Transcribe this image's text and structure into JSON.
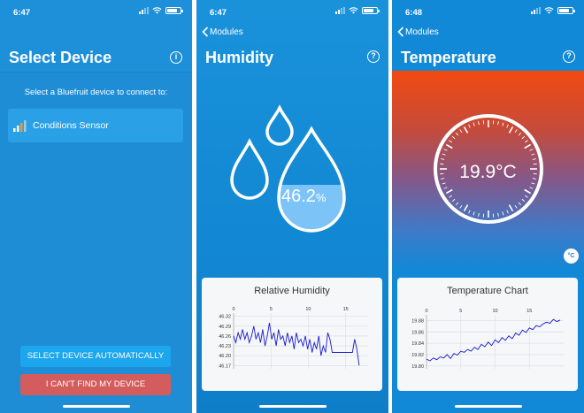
{
  "screens": [
    {
      "status": {
        "time": "6:47"
      },
      "title": "Select Device",
      "prompt": "Select a Bluefruit device to connect to:",
      "device": {
        "name": "Conditions Sensor"
      },
      "buttons": {
        "auto": "SELECT DEVICE AUTOMATICALLY",
        "help": "I CAN'T FIND MY DEVICE"
      }
    },
    {
      "status": {
        "time": "6:47"
      },
      "back": "Modules",
      "title": "Humidity",
      "reading": {
        "value": "46.2",
        "unit": "%"
      },
      "chart_title": "Relative Humidity"
    },
    {
      "status": {
        "time": "6:48"
      },
      "back": "Modules",
      "title": "Temperature",
      "reading": "19.9°C",
      "unit_toggle": "°C",
      "chart_title": "Temperature Chart"
    }
  ],
  "colors": {
    "primary": "#1289d6",
    "danger": "#d55c5c",
    "accent": "#1ba6ee"
  },
  "chart_data": [
    {
      "type": "line",
      "title": "Relative Humidity",
      "xlim": [
        0,
        18
      ],
      "ylim": [
        46.16,
        46.33
      ],
      "xticks": [
        "0",
        "5",
        "10",
        "15"
      ],
      "yticks": [
        "46.32",
        "46.29",
        "46.26",
        "46.23",
        "46.20",
        "46.17"
      ],
      "x": [
        0,
        0.3,
        0.6,
        0.9,
        1.2,
        1.5,
        1.8,
        2.1,
        2.4,
        2.7,
        3,
        3.3,
        3.6,
        3.9,
        4.2,
        4.5,
        4.8,
        5.1,
        5.4,
        5.7,
        6,
        6.3,
        6.6,
        6.9,
        7.2,
        7.5,
        7.8,
        8.1,
        8.4,
        8.7,
        9,
        9.3,
        9.6,
        9.9,
        10.2,
        10.5,
        10.8,
        11.1,
        11.4,
        11.7,
        12,
        12.3,
        12.6,
        12.9,
        13.2,
        13.5,
        13.8,
        14.1,
        14.4,
        14.7,
        15,
        15.3,
        15.6,
        15.9,
        16.2,
        16.5,
        16.8
      ],
      "y": [
        46.26,
        46.24,
        46.27,
        46.25,
        46.28,
        46.25,
        46.27,
        46.24,
        46.26,
        46.29,
        46.25,
        46.27,
        46.24,
        46.28,
        46.23,
        46.26,
        46.3,
        46.25,
        46.27,
        46.23,
        46.28,
        46.25,
        46.26,
        46.23,
        46.27,
        46.24,
        46.26,
        46.22,
        46.27,
        46.24,
        46.25,
        46.23,
        46.26,
        46.22,
        46.25,
        46.21,
        46.24,
        46.22,
        46.26,
        46.2,
        46.23,
        46.21,
        46.27,
        46.25,
        46.21,
        46.21,
        46.21,
        46.21,
        46.21,
        46.21,
        46.21,
        46.21,
        46.21,
        46.21,
        46.25,
        46.22,
        46.17
      ]
    },
    {
      "type": "line",
      "title": "Temperature Chart",
      "xlim": [
        0,
        20
      ],
      "ylim": [
        19.795,
        19.89
      ],
      "xticks": [
        "0",
        "5",
        "10",
        "15"
      ],
      "yticks": [
        "19.88",
        "19.86",
        "19.84",
        "19.82",
        "19.80"
      ],
      "x": [
        0,
        0.5,
        1,
        1.5,
        2,
        2.5,
        3,
        3.5,
        4,
        4.5,
        5,
        5.5,
        6,
        6.5,
        7,
        7.5,
        8,
        8.5,
        9,
        9.5,
        10,
        10.5,
        11,
        11.5,
        12,
        12.5,
        13,
        13.5,
        14,
        14.5,
        15,
        15.5,
        16,
        16.5,
        17,
        17.5,
        18,
        18.5,
        19,
        19.5
      ],
      "y": [
        19.812,
        19.809,
        19.814,
        19.811,
        19.816,
        19.814,
        19.82,
        19.813,
        19.822,
        19.819,
        19.826,
        19.824,
        19.829,
        19.826,
        19.833,
        19.829,
        19.838,
        19.834,
        19.842,
        19.836,
        19.846,
        19.841,
        19.85,
        19.845,
        19.853,
        19.848,
        19.858,
        19.854,
        19.863,
        19.859,
        19.867,
        19.864,
        19.871,
        19.869,
        19.874,
        19.877,
        19.875,
        19.882,
        19.878,
        19.881
      ]
    }
  ]
}
